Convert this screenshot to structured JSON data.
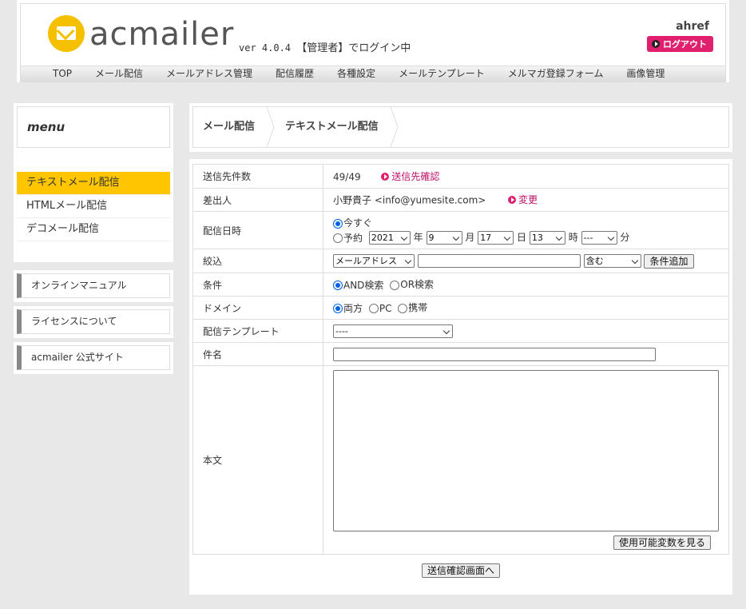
{
  "header": {
    "logo_text": "acmailer",
    "version": "ver 4.0.4",
    "login_status": "【管理者】でログイン中",
    "user": "ahref",
    "logout_label": "ログアウト",
    "accent_color": "#e0206e",
    "logo_color": "#f5c000"
  },
  "nav": [
    "TOP",
    "メール配信",
    "メールアドレス管理",
    "配信履歴",
    "各種設定",
    "メールテンプレート",
    "メルマガ登録フォーム",
    "画像管理"
  ],
  "sidebar": {
    "title": "menu",
    "items": [
      {
        "label": "テキストメール配信",
        "active": true
      },
      {
        "label": "HTMLメール配信",
        "active": false
      },
      {
        "label": "デコメール配信",
        "active": false
      }
    ],
    "links": [
      "オンラインマニュアル",
      "ライセンスについて",
      "acmailer 公式サイト"
    ]
  },
  "breadcrumb": [
    "メール配信",
    "テキストメール配信"
  ],
  "form": {
    "recipients": {
      "label": "送信先件数",
      "value": "49/49",
      "link": "送信先確認"
    },
    "sender": {
      "label": "差出人",
      "value": "小野貴子 <info@yumesite.com>",
      "link": "変更"
    },
    "schedule": {
      "label": "配信日時",
      "now_label": "今すぐ",
      "reserve_label": "予約",
      "year": "2021",
      "year_unit": "年",
      "month": "9",
      "month_unit": "月",
      "day": "17",
      "day_unit": "日",
      "hour": "13",
      "hour_unit": "時",
      "minute": "---",
      "minute_unit": "分"
    },
    "filter": {
      "label": "絞込",
      "field": "メールアドレス",
      "input_value": "",
      "operator": "含む",
      "add_button": "条件追加"
    },
    "condition": {
      "label": "条件",
      "and_label": "AND検索",
      "or_label": "OR検索"
    },
    "domain": {
      "label": "ドメイン",
      "both_label": "両方",
      "pc_label": "PC",
      "mobile_label": "携帯"
    },
    "template": {
      "label": "配信テンプレート",
      "value": "----"
    },
    "subject": {
      "label": "件名",
      "value": ""
    },
    "body": {
      "label": "本文",
      "value": "",
      "vars_button": "使用可能変数を見る"
    },
    "submit_label": "送信確認画面へ"
  }
}
